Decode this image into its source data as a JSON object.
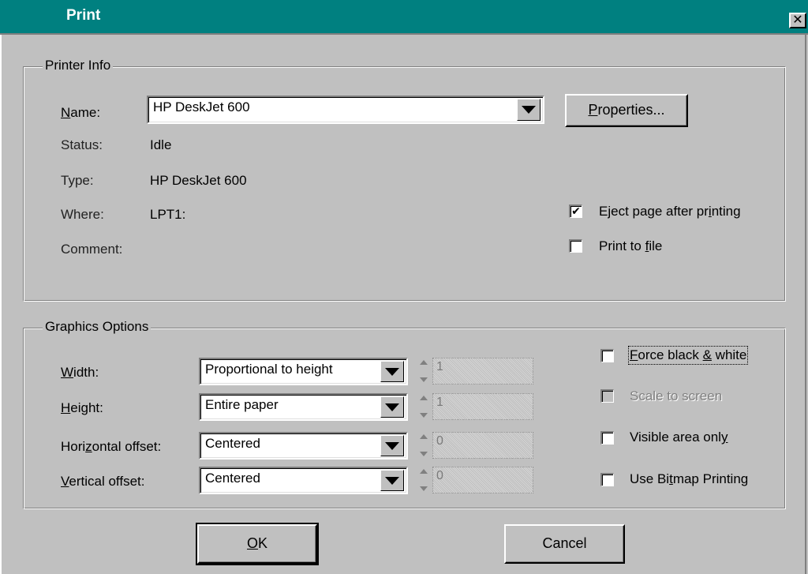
{
  "window": {
    "title": "Print",
    "close_glyph": "✕"
  },
  "printer_info": {
    "legend": "Printer Info",
    "name_label": "Name:",
    "name_value": "HP DeskJet 600",
    "properties_label": "Properties...",
    "status_label": "Status:",
    "status_value": "Idle",
    "type_label": "Type:",
    "type_value": "HP DeskJet 600",
    "where_label": "Where:",
    "where_value": "LPT1:",
    "comment_label": "Comment:",
    "comment_value": "",
    "eject_label": "Eject page after printing",
    "eject_checked": true,
    "print_to_file_label": "Print to file",
    "print_to_file_checked": false
  },
  "graphics_options": {
    "legend": "Graphics Options",
    "width_label": "Width:",
    "width_value": "Proportional to height",
    "width_number": "1",
    "height_label": "Height:",
    "height_value": "Entire paper",
    "height_number": "1",
    "hoffset_label": "Horizontal offset:",
    "hoffset_value": "Centered",
    "hoffset_number": "0",
    "voffset_label": "Vertical offset:",
    "voffset_value": "Centered",
    "voffset_number": "0",
    "force_bw_label": "Force black & white",
    "force_bw_checked": false,
    "scale_to_screen_label": "Scale to screen",
    "scale_to_screen_checked": false,
    "visible_area_label": "Visible area only",
    "visible_area_checked": false,
    "bitmap_printing_label": "Use Bitmap Printing",
    "bitmap_printing_checked": false
  },
  "buttons": {
    "ok_label": "OK",
    "cancel_label": "Cancel"
  },
  "colors": {
    "titlebar": "#008080",
    "face": "#c0c0c0"
  }
}
